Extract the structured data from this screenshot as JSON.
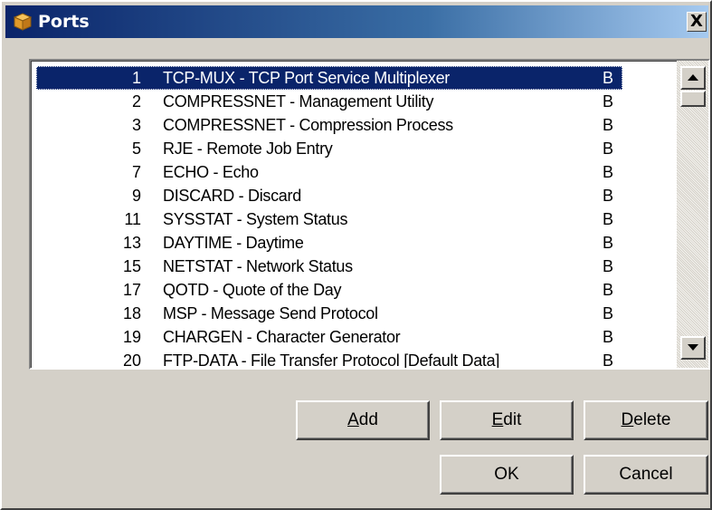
{
  "window": {
    "title": "Ports",
    "close_label": "X"
  },
  "list": {
    "rows": [
      {
        "num": "1",
        "name": "TCP-MUX - TCP Port Service Multiplexer",
        "proto": "B",
        "selected": true
      },
      {
        "num": "2",
        "name": "COMPRESSNET - Management Utility",
        "proto": "B"
      },
      {
        "num": "3",
        "name": "COMPRESSNET - Compression Process",
        "proto": "B"
      },
      {
        "num": "5",
        "name": "RJE - Remote Job Entry",
        "proto": "B"
      },
      {
        "num": "7",
        "name": "ECHO - Echo",
        "proto": "B"
      },
      {
        "num": "9",
        "name": "DISCARD - Discard",
        "proto": "B"
      },
      {
        "num": "11",
        "name": "SYSSTAT - System Status",
        "proto": "B"
      },
      {
        "num": "13",
        "name": "DAYTIME - Daytime",
        "proto": "B"
      },
      {
        "num": "15",
        "name": "NETSTAT - Network Status",
        "proto": "B"
      },
      {
        "num": "17",
        "name": "QOTD - Quote of the Day",
        "proto": "B"
      },
      {
        "num": "18",
        "name": "MSP - Message Send Protocol",
        "proto": "B"
      },
      {
        "num": "19",
        "name": "CHARGEN - Character Generator",
        "proto": "B"
      },
      {
        "num": "20",
        "name": "FTP-DATA - File Transfer Protocol [Default Data]",
        "proto": "B"
      }
    ]
  },
  "buttons": {
    "add": {
      "accel": "A",
      "rest": "dd"
    },
    "edit": {
      "accel": "E",
      "rest": "dit"
    },
    "delete": {
      "accel": "D",
      "rest": "elete"
    },
    "ok": "OK",
    "cancel": "Cancel"
  },
  "icons": {
    "title_icon": "package-icon",
    "scroll_up": "arrow-up-icon",
    "scroll_down": "arrow-down-icon"
  },
  "colors": {
    "selection": "#0a246a",
    "titlebar_start": "#0a246a",
    "titlebar_end": "#a6caf0",
    "face": "#d4d0c8"
  }
}
